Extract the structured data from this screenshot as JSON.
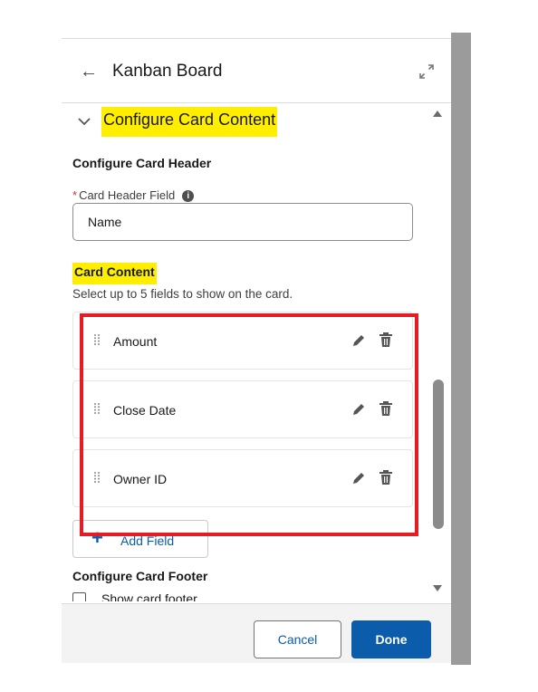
{
  "panel": {
    "title": "Kanban Board",
    "back_icon": "arrow-left-icon",
    "expand_icon": "expand-icon"
  },
  "section": {
    "title": "Configure Card Content",
    "expanded": true,
    "toggle_icon": "chevron-down-icon"
  },
  "card_header": {
    "heading": "Configure Card Header",
    "required_marker": "*",
    "field_label": "Card Header Field",
    "field_value": "Name"
  },
  "card_content": {
    "heading": "Card Content",
    "help_text": "Select up to 5 fields to show on the card.",
    "fields": [
      {
        "label": "Amount"
      },
      {
        "label": "Close Date"
      },
      {
        "label": "Owner ID"
      }
    ],
    "add_button_label": "Add Field"
  },
  "card_footer": {
    "heading": "Configure Card Footer",
    "checkbox_label": "Show card footer",
    "checked": false
  },
  "footer": {
    "cancel_label": "Cancel",
    "done_label": "Done"
  },
  "colors": {
    "highlight": "#ffee00",
    "annotation_box": "#e51c23",
    "brand_blue": "#0b5cab"
  }
}
